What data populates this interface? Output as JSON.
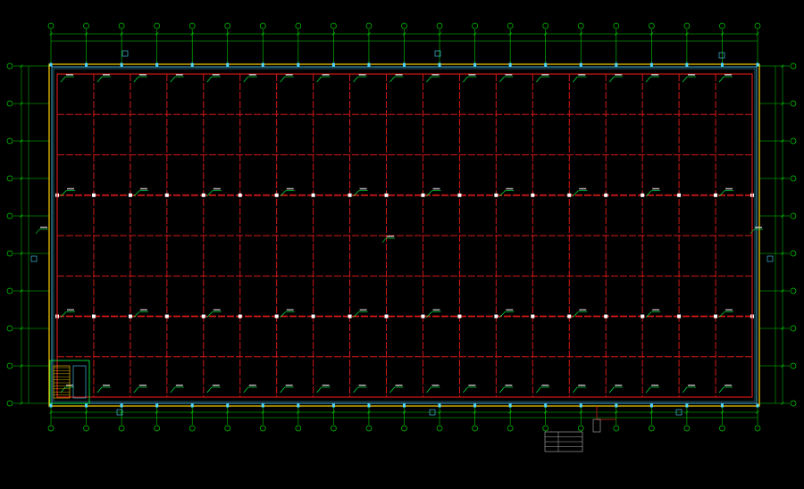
{
  "colors": {
    "background": "#000000",
    "grid_axis": "#00d000",
    "wall": "#ffd200",
    "wall_inner": "#4fd6ff",
    "beam": "#d21818",
    "leader": "#00ff40",
    "text": "#d8d8d8"
  },
  "drawing": {
    "column_lines_count": 21,
    "row_lines_count": 10,
    "major_beam_rows": [
      3,
      6
    ],
    "notes": {
      "bottom_center_heading": "",
      "bottom_center_lines": [
        "",
        ""
      ],
      "bottom_left_lines": [
        "",
        ""
      ],
      "bottom_right_heading": "",
      "bottom_right_table": []
    }
  }
}
